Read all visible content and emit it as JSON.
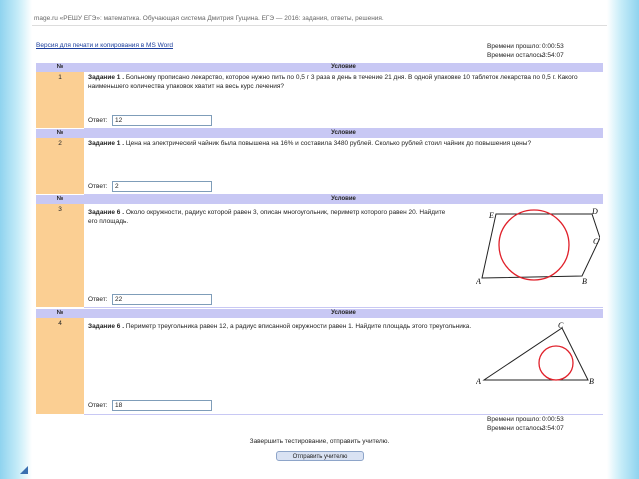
{
  "browser": {
    "tab_title": "mage.ru  «РЕШУ ЕГЭ»: математика. Обучающая система Дмитрия Гущина. ЕГЭ — 2016: задания, ответы, решения."
  },
  "print_link": "Версия для печати и копирования в MS Word",
  "timer_top": {
    "elapsed_label": "Времени прошло:",
    "elapsed": "0:00:53",
    "left_label": "Времени осталось:",
    "left": "3:54:07"
  },
  "table": {
    "col_num": "№",
    "col_cond": "Условие"
  },
  "answer_label": "Ответ:",
  "tasks": [
    {
      "num": "1",
      "title": "Задание 1 .",
      "text": "Больному прописано лекарство, которое нужно пить по 0,5 г 3 раза в день в течение 21 дня. В одной упаковке 10 таблеток лекарства по 0,5 г. Какого наименьшего количества упаковок хватит на весь курс лечения?",
      "answer": "12"
    },
    {
      "num": "2",
      "title": "Задание 1 .",
      "text": "Цена на электрический чайник была повышена на 16% и составила 3480 рублей. Сколько рублей стоил чайник до повышения цены?",
      "answer": "2"
    },
    {
      "num": "3",
      "title": "Задание 6 .",
      "text": "Около окружности, радиус которой равен 3, описан многоугольник, периметр которого равен 20. Найдите его площадь.",
      "answer": "22",
      "figure_labels": [
        "E",
        "D",
        "C",
        "A",
        "B"
      ]
    },
    {
      "num": "4",
      "title": "Задание 6 .",
      "text": "Периметр треугольника равен 12, а радиус вписанной окружности равен 1. Найдите площадь этого треугольника.",
      "answer": "18",
      "figure_labels": [
        "C",
        "A",
        "B"
      ]
    }
  ],
  "timer_bottom": {
    "elapsed_label": "Времени прошло:",
    "elapsed": "0:00:53",
    "left_label": "Времени осталось:",
    "left": "3:54:07"
  },
  "finish_text": "Завершить тестирование, отправить учителю.",
  "send_button": "Отправить учителю",
  "colors": {
    "header": "#c8c8f4",
    "number_column": "#fbcf93",
    "circle": "#e0202a"
  }
}
